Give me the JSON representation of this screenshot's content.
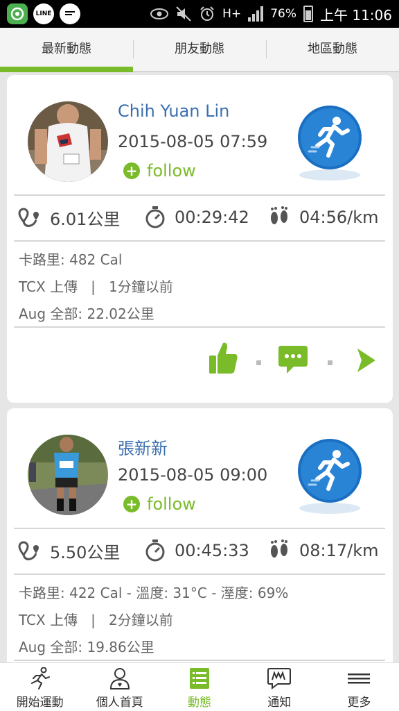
{
  "status_bar": {
    "apps": [
      {
        "icon": "tablet-app-icon",
        "color": "#4caf50",
        "label": ""
      },
      {
        "icon": "line-app-icon",
        "color": "#fff",
        "label": "LINE"
      },
      {
        "icon": "chat-app-icon",
        "color": "#fff",
        "label": ""
      }
    ],
    "network": "H+",
    "battery": "76%",
    "time": "上午 11:06"
  },
  "tabs": [
    {
      "label": "最新動態",
      "active": true
    },
    {
      "label": "朋友動態",
      "active": false
    },
    {
      "label": "地區動態",
      "active": false
    }
  ],
  "posts": [
    {
      "name": "Chih Yuan Lin",
      "datetime": "2015-08-05 07:59",
      "follow_label": "follow",
      "distance": "6.01公里",
      "duration": "00:29:42",
      "pace": "04:56/km",
      "calories": "卡路里: 482 Cal",
      "source": "TCX 上傳",
      "separator": "|",
      "ago": "1分鐘以前",
      "month_total": "Aug 全部:  22.02公里"
    },
    {
      "name": "張新新",
      "datetime": "2015-08-05 09:00",
      "follow_label": "follow",
      "distance": "5.50公里",
      "duration": "00:45:33",
      "pace": "08:17/km",
      "calories": "卡路里: 422 Cal  -  溫度: 31°C  -  溼度: 69%",
      "source": "TCX 上傳",
      "separator": "|",
      "ago": "2分鐘以前",
      "month_total": "Aug 全部:  19.86公里"
    }
  ],
  "bottom_nav": [
    {
      "label": "開始運動",
      "icon": "running-man-icon",
      "active": false
    },
    {
      "label": "個人首頁",
      "icon": "user-icon",
      "active": false
    },
    {
      "label": "動態",
      "icon": "list-icon",
      "active": true
    },
    {
      "label": "通知",
      "icon": "notification-bubble-icon",
      "active": false
    },
    {
      "label": "更多",
      "icon": "menu-icon",
      "active": false
    }
  ],
  "colors": {
    "accent": "#79bb29",
    "link": "#3a6fb0",
    "run_badge": "#1a6fc1"
  }
}
